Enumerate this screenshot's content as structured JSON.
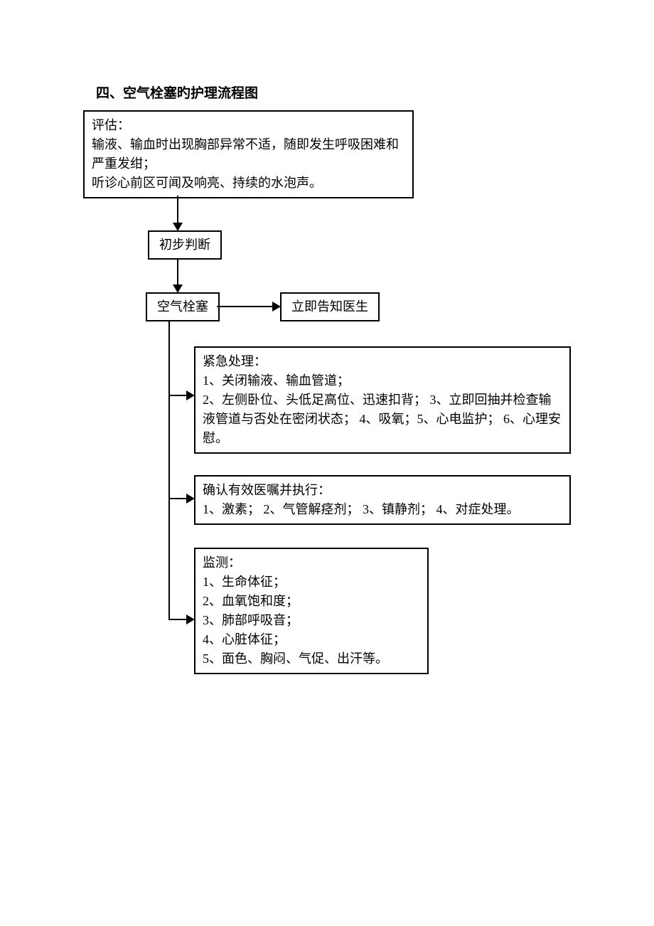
{
  "title": "四、空气栓塞旳护理流程图",
  "boxes": {
    "evaluation": "评估：\n输液、输血时出现胸部异常不适，随即发生呼吸困难和严重发绀；\n听诊心前区可闻及响亮、持续的水泡声。",
    "preliminary": "初步判断",
    "embolism": "空气栓塞",
    "notify": "立即告知医生",
    "emergency": "紧急处理：\n1、关闭输液、输血管道；\n2、左侧卧位、头低足高位、迅速扣背；  3、立即回抽并检查输液管道与否处在密闭状态；  4、吸氧；5、心电监护；  6、心理安慰。",
    "confirm": "确认有效医嘱并执行：\n1、激素；  2、气管解痉剂；  3、镇静剂；  4、对症处理。",
    "monitor": "监测：\n1、生命体征；\n2、血氧饱和度；\n3、肺部呼吸音；\n4、心脏体征；\n5、面色、胸闷、气促、出汗等。"
  }
}
